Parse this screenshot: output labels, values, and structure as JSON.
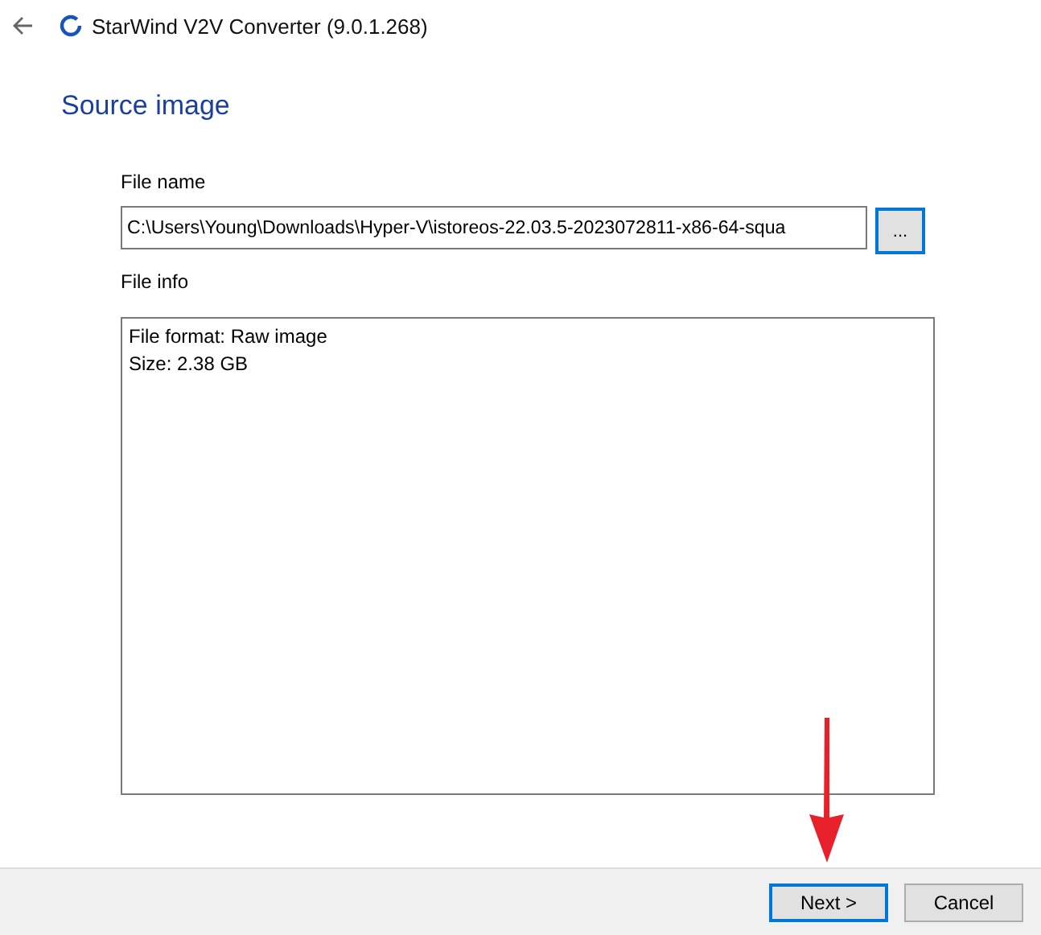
{
  "window": {
    "title": "StarWind V2V Converter (9.0.1.268)"
  },
  "page": {
    "heading": "Source image",
    "file_name": {
      "label": "File name",
      "value": "C:\\Users\\Young\\Downloads\\Hyper-V\\istoreos-22.03.5-2023072811-x86-64-squa",
      "browse": "..."
    },
    "file_info": {
      "label": "File info",
      "lines": [
        "File format: Raw image",
        "Size: 2.38 GB"
      ]
    }
  },
  "buttons": [
    {
      "label": "Next >",
      "focused": true
    },
    {
      "label": "Cancel",
      "focused": false
    }
  ]
}
